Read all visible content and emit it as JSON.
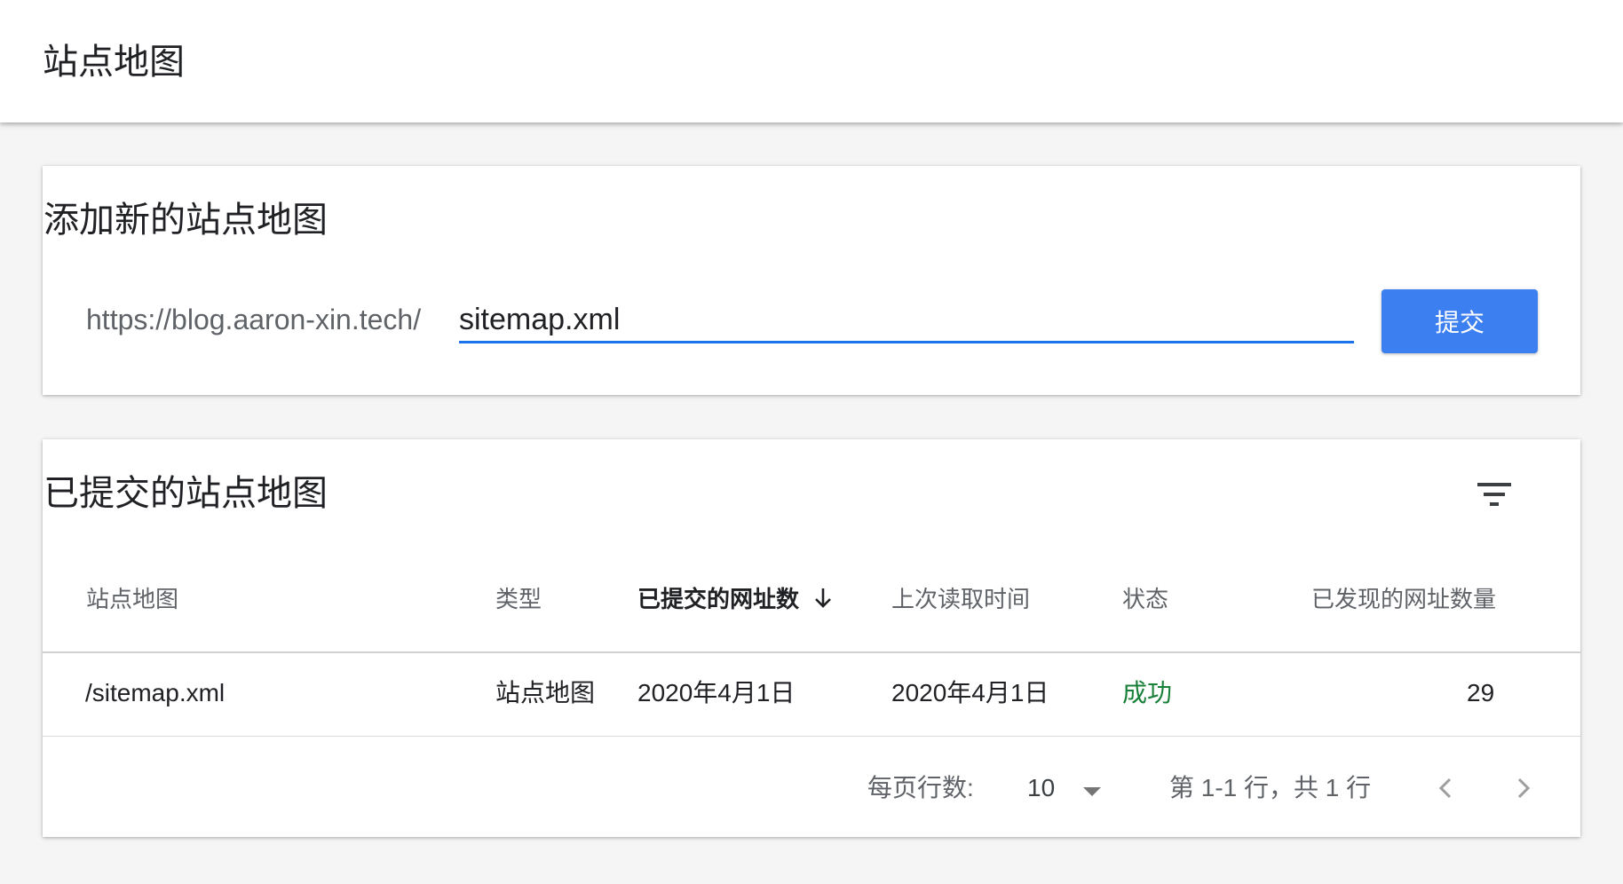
{
  "header": {
    "title": "站点地图"
  },
  "add_sitemap": {
    "title": "添加新的站点地图",
    "url_prefix": "https://blog.aaron-xin.tech/",
    "input_value": "sitemap.xml",
    "submit_label": "提交"
  },
  "submitted": {
    "title": "已提交的站点地图",
    "columns": {
      "sitemap": "站点地图",
      "type": "类型",
      "submitted_urls": "已提交的网址数",
      "last_read": "上次读取时间",
      "status": "状态",
      "discovered_urls": "已发现的网址数量"
    },
    "rows": [
      {
        "sitemap": "/sitemap.xml",
        "type": "站点地图",
        "submitted": "2020年4月1日",
        "last_read": "2020年4月1日",
        "status": "成功",
        "discovered": "29"
      }
    ],
    "pagination": {
      "rows_per_page_label": "每页行数:",
      "rows_per_page_value": "10",
      "range_text": "第 1-1 行，共 1 行"
    }
  },
  "colors": {
    "accent": "#1a73e8",
    "button": "#3c7ff0",
    "success": "#188038"
  },
  "icons": [
    "filter-icon",
    "sort-arrow-down-icon",
    "dropdown-arrow-icon",
    "chevron-left-icon",
    "chevron-right-icon"
  ]
}
